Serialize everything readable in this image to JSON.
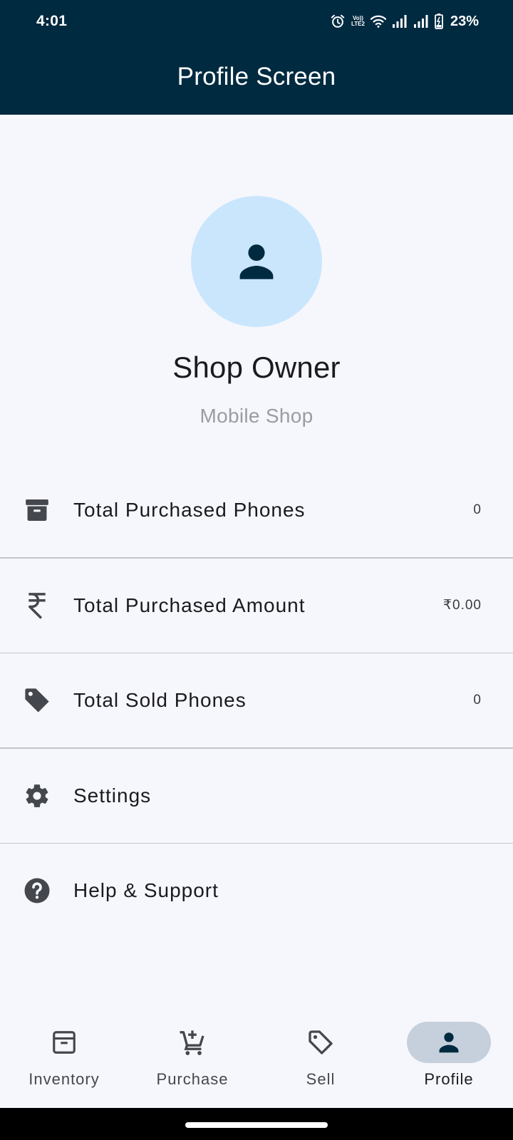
{
  "status_bar": {
    "time": "4:01",
    "battery": "23%",
    "network_label_top": "Vo))",
    "network_label_bottom": "LTE2"
  },
  "app_bar": {
    "title": "Profile Screen"
  },
  "profile": {
    "name": "Shop Owner",
    "subtitle": "Mobile Shop",
    "avatar_icon": "person-icon"
  },
  "list": {
    "items": [
      {
        "icon": "archive-box-icon",
        "label": "Total Purchased Phones",
        "value": "0"
      },
      {
        "icon": "rupee-icon",
        "label": "Total Purchased Amount",
        "value": "₹0.00"
      },
      {
        "icon": "tag-icon",
        "label": "Total Sold Phones",
        "value": "0"
      },
      {
        "icon": "gear-icon",
        "label": "Settings",
        "value": ""
      },
      {
        "icon": "help-circle-icon",
        "label": "Help & Support",
        "value": ""
      }
    ]
  },
  "bottom_nav": {
    "items": [
      {
        "label": "Inventory",
        "icon": "archive-box-outline-icon",
        "active": false
      },
      {
        "label": "Purchase",
        "icon": "cart-plus-icon",
        "active": false
      },
      {
        "label": "Sell",
        "icon": "tag-outline-icon",
        "active": false
      },
      {
        "label": "Profile",
        "icon": "person-icon",
        "active": true
      }
    ]
  },
  "colors": {
    "app_bar": "#002a40",
    "background": "#f6f7fc",
    "avatar_bg": "#c9e6fd",
    "active_pill": "#c6d0dc"
  }
}
